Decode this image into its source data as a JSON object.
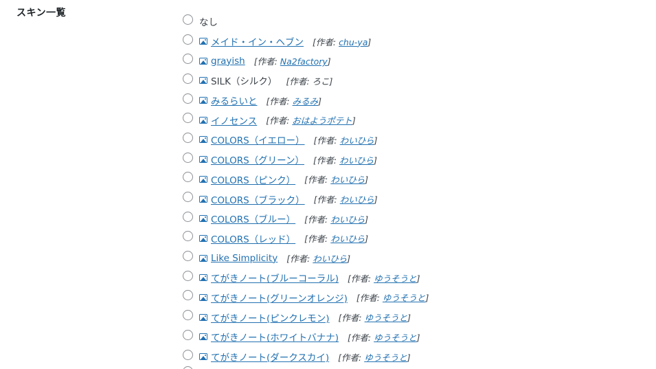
{
  "section": {
    "title": "スキン一覧"
  },
  "skins": [
    {
      "name": "なし",
      "has_icon": false,
      "linked": false,
      "author": null
    },
    {
      "name": "メイド・イン・ヘブン",
      "has_icon": true,
      "linked": true,
      "author": {
        "prefix": "[作者: ",
        "name": "chu-ya",
        "linked": true,
        "suffix": "]"
      }
    },
    {
      "name": "grayish",
      "has_icon": true,
      "linked": true,
      "author": {
        "prefix": "[作者: ",
        "name": "Na2factory",
        "linked": true,
        "suffix": "]"
      }
    },
    {
      "name": "SILK（シルク）",
      "has_icon": true,
      "linked": false,
      "author": {
        "prefix": "[作者: ",
        "name": "ろこ",
        "linked": false,
        "suffix": "]"
      }
    },
    {
      "name": "みるらいと",
      "has_icon": true,
      "linked": true,
      "author": {
        "prefix": "[作者: ",
        "name": "みるみ",
        "linked": true,
        "suffix": "]"
      }
    },
    {
      "name": "イノセンス",
      "has_icon": true,
      "linked": true,
      "author": {
        "prefix": "[作者: ",
        "name": "おはようポテト",
        "linked": true,
        "suffix": "]"
      }
    },
    {
      "name": "COLORS（イエロー）",
      "has_icon": true,
      "linked": true,
      "author": {
        "prefix": "[作者: ",
        "name": "わいひら",
        "linked": true,
        "suffix": "]"
      }
    },
    {
      "name": "COLORS（グリーン）",
      "has_icon": true,
      "linked": true,
      "author": {
        "prefix": "[作者: ",
        "name": "わいひら",
        "linked": true,
        "suffix": "]"
      }
    },
    {
      "name": "COLORS（ピンク）",
      "has_icon": true,
      "linked": true,
      "author": {
        "prefix": "[作者: ",
        "name": "わいひら",
        "linked": true,
        "suffix": "]"
      }
    },
    {
      "name": "COLORS（ブラック）",
      "has_icon": true,
      "linked": true,
      "author": {
        "prefix": "[作者: ",
        "name": "わいひら",
        "linked": true,
        "suffix": "]"
      }
    },
    {
      "name": "COLORS（ブルー）",
      "has_icon": true,
      "linked": true,
      "author": {
        "prefix": "[作者: ",
        "name": "わいひら",
        "linked": true,
        "suffix": "]"
      }
    },
    {
      "name": "COLORS（レッド）",
      "has_icon": true,
      "linked": true,
      "author": {
        "prefix": "[作者: ",
        "name": "わいひら",
        "linked": true,
        "suffix": "]"
      }
    },
    {
      "name": "Like Simplicity",
      "has_icon": true,
      "linked": true,
      "author": {
        "prefix": "[作者: ",
        "name": "わいひら",
        "linked": true,
        "suffix": "]"
      }
    },
    {
      "name": "てがきノート(ブルーコーラル)",
      "has_icon": true,
      "linked": true,
      "author": {
        "prefix": "[作者: ",
        "name": "ゆうそうと",
        "linked": true,
        "suffix": "]"
      }
    },
    {
      "name": "てがきノート(グリーンオレンジ)",
      "has_icon": true,
      "linked": true,
      "author": {
        "prefix": "[作者: ",
        "name": "ゆうそうと",
        "linked": true,
        "suffix": "]"
      }
    },
    {
      "name": "てがきノート(ピンクレモン)",
      "has_icon": true,
      "linked": true,
      "author": {
        "prefix": "[作者: ",
        "name": "ゆうそうと",
        "linked": true,
        "suffix": "]"
      }
    },
    {
      "name": "てがきノート(ホワイトバナナ)",
      "has_icon": true,
      "linked": true,
      "author": {
        "prefix": "[作者: ",
        "name": "ゆうそうと",
        "linked": true,
        "suffix": "]"
      }
    },
    {
      "name": "てがきノート(ダークスカイ)",
      "has_icon": true,
      "linked": true,
      "author": {
        "prefix": "[作者: ",
        "name": "ゆうそうと",
        "linked": true,
        "suffix": "]"
      }
    }
  ],
  "colors": {
    "link": "#2271b1",
    "text": "#3c434a",
    "radio_border": "#8c8f94"
  }
}
